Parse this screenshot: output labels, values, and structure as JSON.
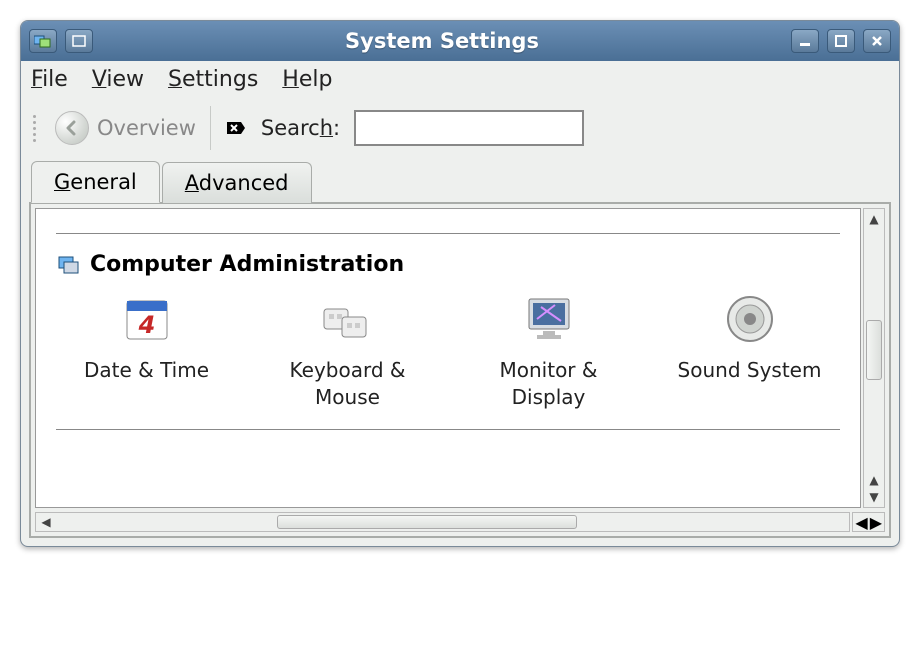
{
  "window": {
    "title": "System Settings"
  },
  "menubar": {
    "file": "File",
    "view": "View",
    "settings": "Settings",
    "help": "Help"
  },
  "toolbar": {
    "overview_label": "Overview",
    "search_label": "Search:",
    "search_value": ""
  },
  "tabs": {
    "general": "General",
    "advanced": "Advanced",
    "active": "general"
  },
  "section": {
    "title": "Computer Administration",
    "items": [
      {
        "label": "Date & Time"
      },
      {
        "label": "Keyboard & Mouse"
      },
      {
        "label": "Monitor & Display"
      },
      {
        "label": "Sound System"
      }
    ]
  }
}
